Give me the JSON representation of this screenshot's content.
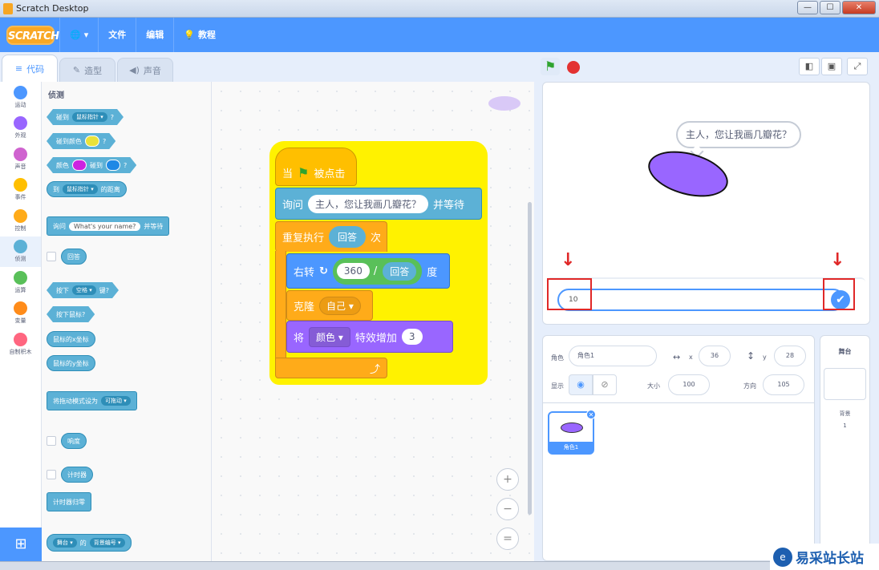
{
  "window": {
    "title": "Scratch Desktop",
    "minimize": "—",
    "maximize": "☐",
    "close": "✕"
  },
  "menubar": {
    "logo": "SCRATCH",
    "file": "文件",
    "edit": "编辑",
    "tutorials": "教程"
  },
  "tabs": {
    "code": "代码",
    "costumes": "造型",
    "sounds": "声音"
  },
  "categories": [
    {
      "label": "运动",
      "color": "#4c97ff"
    },
    {
      "label": "外观",
      "color": "#9966ff"
    },
    {
      "label": "声音",
      "color": "#cf63cf"
    },
    {
      "label": "事件",
      "color": "#ffbf00"
    },
    {
      "label": "控制",
      "color": "#ffab19"
    },
    {
      "label": "侦测",
      "color": "#5cb1d6"
    },
    {
      "label": "运算",
      "color": "#59c059"
    },
    {
      "label": "变量",
      "color": "#ff8c1a"
    },
    {
      "label": "自制积木",
      "color": "#ff6680"
    }
  ],
  "palette": {
    "heading": "侦测",
    "touching": "碰到",
    "touching_target": "鼠标指针",
    "touching_color": "碰到颜色",
    "color_label": "颜色",
    "color_touching": "碰到",
    "distance_to": "到",
    "distance_target": "鼠标指针",
    "distance_suffix": "的距离",
    "ask_prefix": "询问",
    "ask_default": "What's your name?",
    "ask_suffix": "并等待",
    "answer": "回答",
    "key_pressed": "按下",
    "key_name": "空格",
    "key_suffix": "键?",
    "mouse_down": "按下鼠标?",
    "mouse_x": "鼠标的x坐标",
    "mouse_y": "鼠标的y坐标",
    "drag_mode": "将拖动模式设为",
    "drag_value": "可拖动",
    "loudness": "响度",
    "timer": "计时器",
    "reset_timer": "计时器归零",
    "of_target": "舞台",
    "of_label": "的",
    "of_prop": "背景编号"
  },
  "script": {
    "when": "当",
    "flag_clicked": "被点击",
    "ask": "询问",
    "ask_text": "主人，您让我画几瓣花？",
    "and_wait": "并等待",
    "repeat": "重复执行",
    "repeat_arg": "回答",
    "times": "次",
    "turn": "右转",
    "turn_num": "360",
    "divide": "/",
    "turn_den": "回答",
    "degrees": "度",
    "clone": "克隆",
    "clone_target": "自己",
    "change": "将",
    "effect": "颜色",
    "effect_by": "特效增加",
    "effect_value": "3",
    "loop_arrow": "⤴"
  },
  "zoom": {
    "in": "+",
    "out": "−",
    "reset": "="
  },
  "stage": {
    "speech": "主人，您让我画几瓣花？",
    "answer_value": "10",
    "submit": "✔"
  },
  "sprite_info": {
    "sprite_label": "角色",
    "sprite_name": "角色1",
    "x_label": "x",
    "x_value": "36",
    "y_label": "y",
    "y_value": "28",
    "show_label": "显示",
    "size_label": "大小",
    "size_value": "100",
    "direction_label": "方向",
    "direction_value": "105"
  },
  "sprites": [
    {
      "name": "角色1"
    }
  ],
  "stage_pane": {
    "title": "舞台",
    "backdrops_label": "背景",
    "backdrops_count": "1"
  },
  "watermark": {
    "text": "易采站长站"
  }
}
